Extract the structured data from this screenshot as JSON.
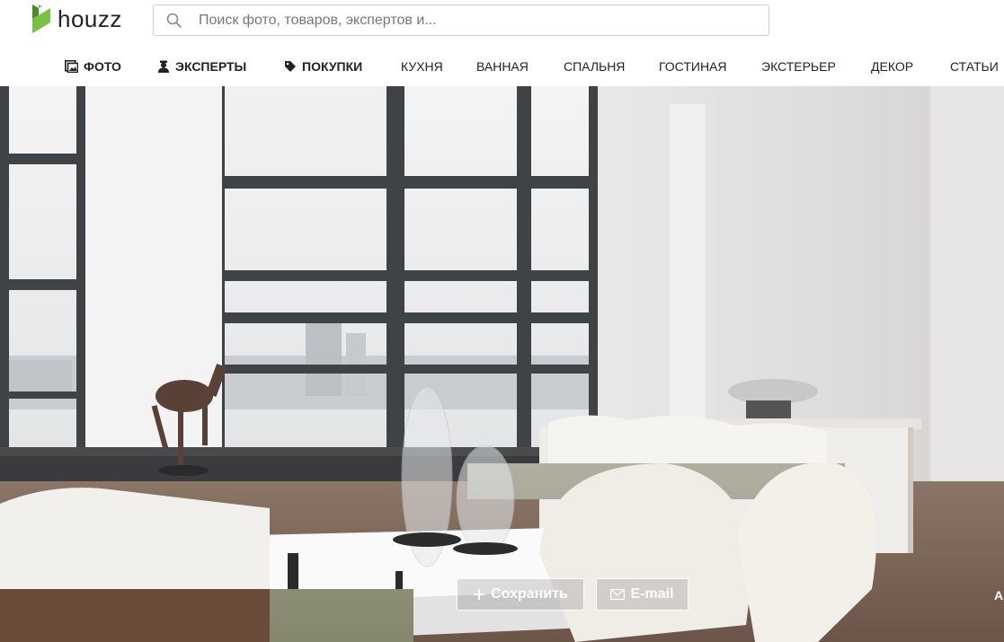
{
  "brand": {
    "name": "houzz",
    "logo_colors": [
      "#7ac142",
      "#4d8c2a"
    ]
  },
  "search": {
    "placeholder": "Поиск фото, товаров, экспертов и...",
    "value": "",
    "icon": "search-icon"
  },
  "nav": {
    "items": [
      {
        "label": "ФОТО",
        "icon": "photo-icon"
      },
      {
        "label": "ЭКСПЕРТЫ",
        "icon": "expert-icon"
      },
      {
        "label": "ПОКУПКИ",
        "icon": "tag-icon"
      },
      {
        "label": "КУХНЯ"
      },
      {
        "label": "ВАННАЯ"
      },
      {
        "label": "СПАЛЬНЯ"
      },
      {
        "label": "ГОСТИНАЯ"
      },
      {
        "label": "ЭКСТЕРЬЕР"
      },
      {
        "label": "ДЕКОР"
      },
      {
        "label": "СТАТЬИ"
      }
    ]
  },
  "hero": {
    "actions": {
      "save_label": "Сохранить",
      "email_label": "E-mail",
      "partial_label": "A"
    }
  },
  "colors": {
    "text": "#222222",
    "accent": "#7ac142",
    "border": "#cfcfcf"
  }
}
